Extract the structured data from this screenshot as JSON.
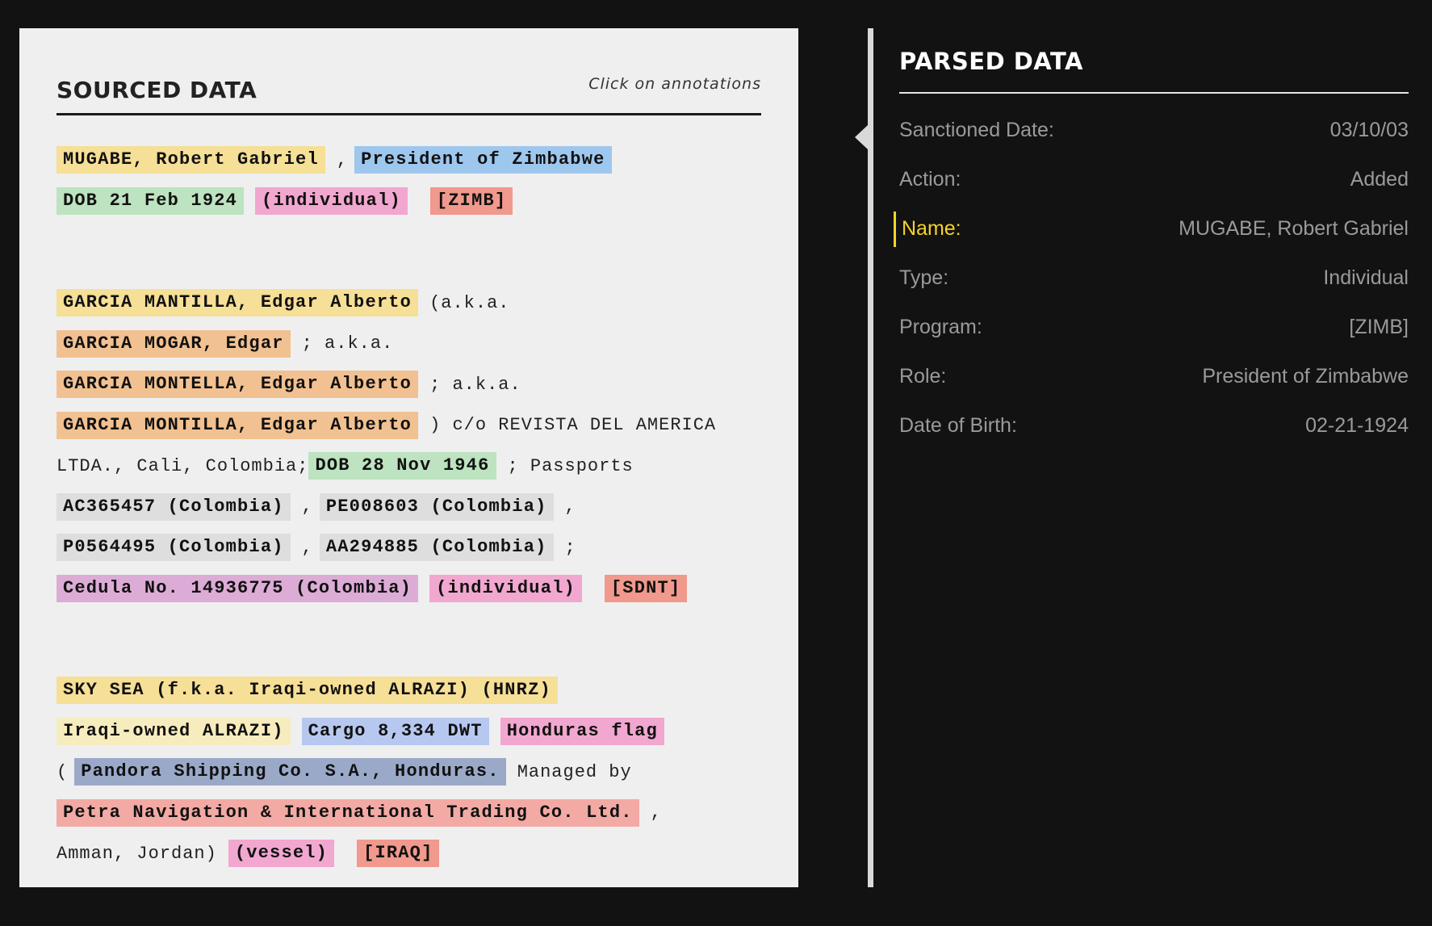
{
  "sourced": {
    "title": "SOURCED DATA",
    "hint": "Click on annotations",
    "entries": [
      {
        "lines": [
          [
            {
              "text": "MUGABE, Robert Gabriel",
              "kind": "name",
              "color": "#f6df96"
            },
            {
              "text": ",",
              "kind": "plain"
            },
            {
              "text": "President of Zimbabwe",
              "kind": "role",
              "color": "#9ec7ee"
            }
          ],
          [
            {
              "text": "DOB 21 Feb 1924",
              "kind": "dob",
              "color": "#bde3c0"
            },
            {
              "text": "(individual)",
              "kind": "type",
              "color": "#f1a7cf"
            },
            {
              "text": "[ZIMB]",
              "kind": "program",
              "color": "#f0998c"
            }
          ]
        ]
      },
      {
        "lines": [
          [
            {
              "text": "GARCIA MANTILLA, Edgar Alberto",
              "kind": "name",
              "color": "#f6df96"
            },
            {
              "text": "(a.k.a.",
              "kind": "plain"
            }
          ],
          [
            {
              "text": "GARCIA MOGAR, Edgar",
              "kind": "alias",
              "color": "#f2c191"
            },
            {
              "text": "; a.k.a.",
              "kind": "plain"
            }
          ],
          [
            {
              "text": "GARCIA MONTELLA, Edgar Alberto",
              "kind": "alias",
              "color": "#f2c191"
            },
            {
              "text": "; a.k.a.",
              "kind": "plain"
            }
          ],
          [
            {
              "text": "GARCIA MONTILLA, Edgar Alberto",
              "kind": "alias",
              "color": "#f2c191"
            },
            {
              "text": ") c/o REVISTA DEL AMERICA",
              "kind": "plain"
            }
          ],
          [
            {
              "text": "LTDA., Cali, Colombia;",
              "kind": "plain"
            },
            {
              "text": "DOB 28 Nov 1946",
              "kind": "dob",
              "color": "#bde3c0"
            },
            {
              "text": "; Passports",
              "kind": "plain"
            }
          ],
          [
            {
              "text": "AC365457 (Colombia)",
              "kind": "passport",
              "color": "#dedede"
            },
            {
              "text": ",",
              "kind": "plain"
            },
            {
              "text": "PE008603 (Colombia)",
              "kind": "passport",
              "color": "#dedede"
            },
            {
              "text": ",",
              "kind": "plain"
            }
          ],
          [
            {
              "text": "P0564495 (Colombia)",
              "kind": "passport",
              "color": "#dedede"
            },
            {
              "text": ",",
              "kind": "plain"
            },
            {
              "text": "AA294885 (Colombia)",
              "kind": "passport",
              "color": "#dedede"
            },
            {
              "text": ";",
              "kind": "plain"
            }
          ],
          [
            {
              "text": "Cedula No. 14936775 (Colombia)",
              "kind": "id",
              "color": "#dcacd6"
            },
            {
              "text": "(individual)",
              "kind": "type",
              "color": "#f1a7cf"
            },
            {
              "text": "[SDNT]",
              "kind": "program",
              "color": "#f0998c"
            }
          ]
        ]
      },
      {
        "lines": [
          [
            {
              "text": "SKY SEA (f.k.a. Iraqi-owned ALRAZI) (HNRZ)",
              "kind": "name",
              "color": "#f6df96"
            }
          ],
          [
            {
              "text": "Iraqi-owned ALRAZI)",
              "kind": "alias",
              "color": "#f7ecbe"
            },
            {
              "text": "Cargo 8,334 DWT",
              "kind": "cargo",
              "color": "#b7c8f0"
            },
            {
              "text": "Honduras flag",
              "kind": "flag",
              "color": "#f1a7cf"
            }
          ],
          [
            {
              "text": "(",
              "kind": "plain"
            },
            {
              "text": "Pandora Shipping Co. S.A., Honduras.",
              "kind": "owner",
              "color": "#9ba9c9"
            },
            {
              "text": "Managed by",
              "kind": "plain"
            }
          ],
          [
            {
              "text": "Petra Navigation & International Trading Co. Ltd.",
              "kind": "manager",
              "color": "#f3aaa4"
            },
            {
              "text": ",",
              "kind": "plain"
            }
          ],
          [
            {
              "text": "Amman, Jordan)",
              "kind": "plain"
            },
            {
              "text": "(vessel)",
              "kind": "type",
              "color": "#f1a7cf"
            },
            {
              "text": "[IRAQ]",
              "kind": "program",
              "color": "#f0998c"
            }
          ]
        ]
      }
    ]
  },
  "parsed": {
    "title": "PARSED DATA",
    "accent_color": "#f5d328",
    "fields": [
      {
        "label": "Sanctioned Date:",
        "value": "03/10/03",
        "active": false
      },
      {
        "label": "Action:",
        "value": "Added",
        "active": false
      },
      {
        "label": "Name:",
        "value": "MUGABE, Robert Gabriel",
        "active": true
      },
      {
        "label": "Type:",
        "value": "Individual",
        "active": false
      },
      {
        "label": "Program:",
        "value": "[ZIMB]",
        "active": false
      },
      {
        "label": "Role:",
        "value": "President of Zimbabwe",
        "active": false
      },
      {
        "label": "Date of Birth:",
        "value": "02-21-1924",
        "active": false
      }
    ]
  }
}
